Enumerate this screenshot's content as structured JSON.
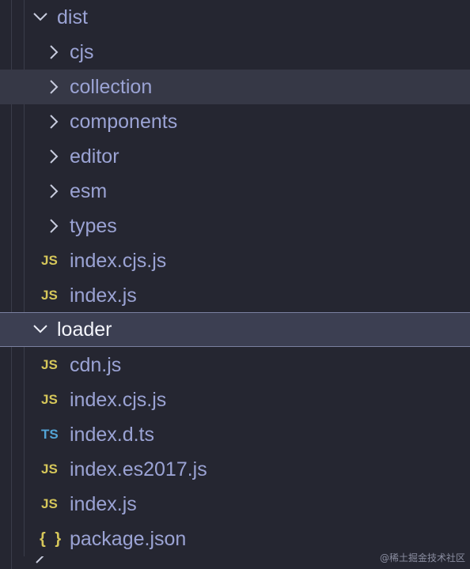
{
  "explorer": {
    "rows": [
      {
        "kind": "folder",
        "expanded": true,
        "label": "dist"
      },
      {
        "kind": "folder",
        "expanded": false,
        "label": "cjs"
      },
      {
        "kind": "folder",
        "expanded": false,
        "label": "collection"
      },
      {
        "kind": "folder",
        "expanded": false,
        "label": "components"
      },
      {
        "kind": "folder",
        "expanded": false,
        "label": "editor"
      },
      {
        "kind": "folder",
        "expanded": false,
        "label": "esm"
      },
      {
        "kind": "folder",
        "expanded": false,
        "label": "types"
      },
      {
        "kind": "file",
        "badge": "JS",
        "label": "index.cjs.js"
      },
      {
        "kind": "file",
        "badge": "JS",
        "label": "index.js"
      },
      {
        "kind": "folder",
        "expanded": true,
        "label": "loader"
      },
      {
        "kind": "file",
        "badge": "JS",
        "label": "cdn.js"
      },
      {
        "kind": "file",
        "badge": "JS",
        "label": "index.cjs.js"
      },
      {
        "kind": "file",
        "badge": "TS",
        "label": "index.d.ts"
      },
      {
        "kind": "file",
        "badge": "JS",
        "label": "index.es2017.js"
      },
      {
        "kind": "file",
        "badge": "JS",
        "label": "index.js"
      },
      {
        "kind": "file",
        "badge": "{ }",
        "label": "package.json"
      }
    ],
    "hover_row_label": "collection",
    "selected_row_label": "loader"
  },
  "watermark": "@稀土掘金技术社区",
  "colors": {
    "background": "#252631",
    "hover": "#363846",
    "selected": "#3c3f52",
    "text": "#9ba3d4",
    "js_badge": "#d6c75a",
    "ts_badge": "#53a4d6"
  }
}
